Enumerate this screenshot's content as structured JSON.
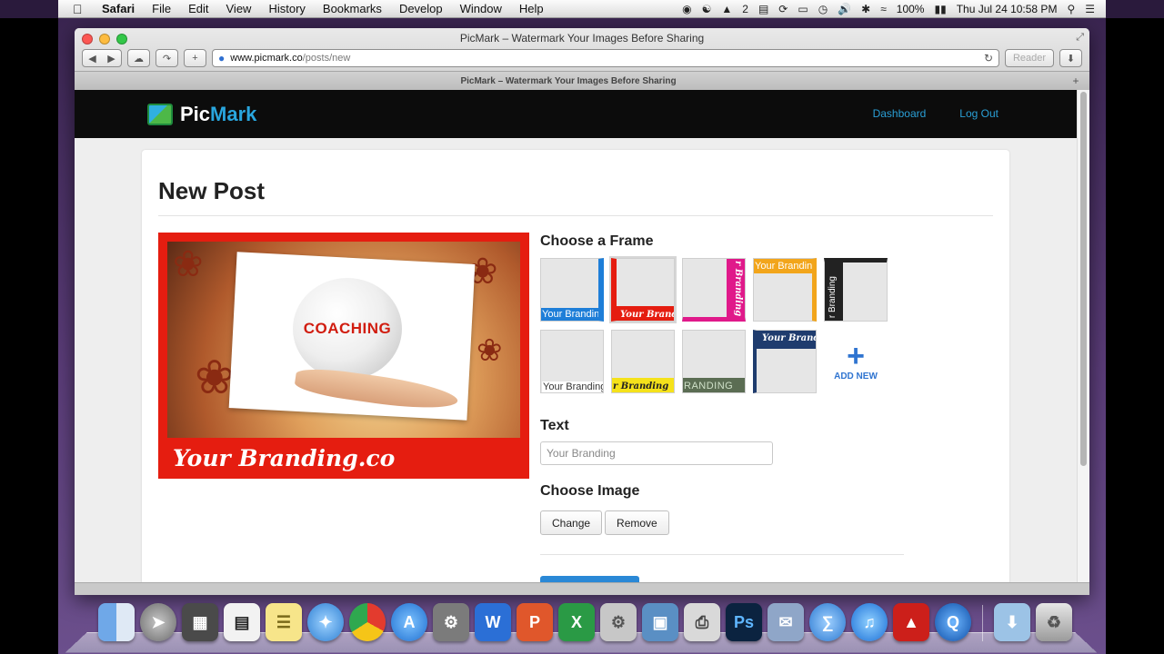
{
  "menubar": {
    "app": "Safari",
    "items": [
      "File",
      "Edit",
      "View",
      "History",
      "Bookmarks",
      "Develop",
      "Window",
      "Help"
    ],
    "adobe_badge": "2",
    "battery": "100%",
    "clock": "Thu Jul 24  10:58 PM"
  },
  "browser": {
    "window_title": "PicMark – Watermark Your Images Before Sharing",
    "url_host": "www.picmark.co",
    "url_path": "/posts/new",
    "reader_label": "Reader",
    "tab_title": "PicMark – Watermark Your Images Before Sharing"
  },
  "site": {
    "brand_pic": "Pic",
    "brand_mark": "Mark",
    "nav": {
      "dashboard": "Dashboard",
      "logout": "Log Out"
    }
  },
  "form": {
    "page_title": "New Post",
    "preview": {
      "center_word": "COACHING",
      "branding_text": "Your Branding.co"
    },
    "choose_frame_label": "Choose a Frame",
    "frames": [
      {
        "text": "Your Branding",
        "color": "#1e7ed8"
      },
      {
        "text": "Your Brandi",
        "color": "#e51d10"
      },
      {
        "text": "r Branding",
        "color": "#e0198a"
      },
      {
        "text": "Your Branding",
        "color": "#f2a51b"
      },
      {
        "text": "r Branding",
        "color": "#222222"
      },
      {
        "text": "Your Branding",
        "color": "#ffffff"
      },
      {
        "text": "r Branding",
        "color": "#f5e21b"
      },
      {
        "text": "RANDING",
        "color": "#5b6d53"
      },
      {
        "text": "Your Brandi",
        "color": "#1f3c6e"
      }
    ],
    "add_new_label": "ADD NEW",
    "text_label": "Text",
    "text_placeholder": "Your Branding",
    "choose_image_label": "Choose Image",
    "change_button": "Change",
    "remove_button": "Remove"
  }
}
